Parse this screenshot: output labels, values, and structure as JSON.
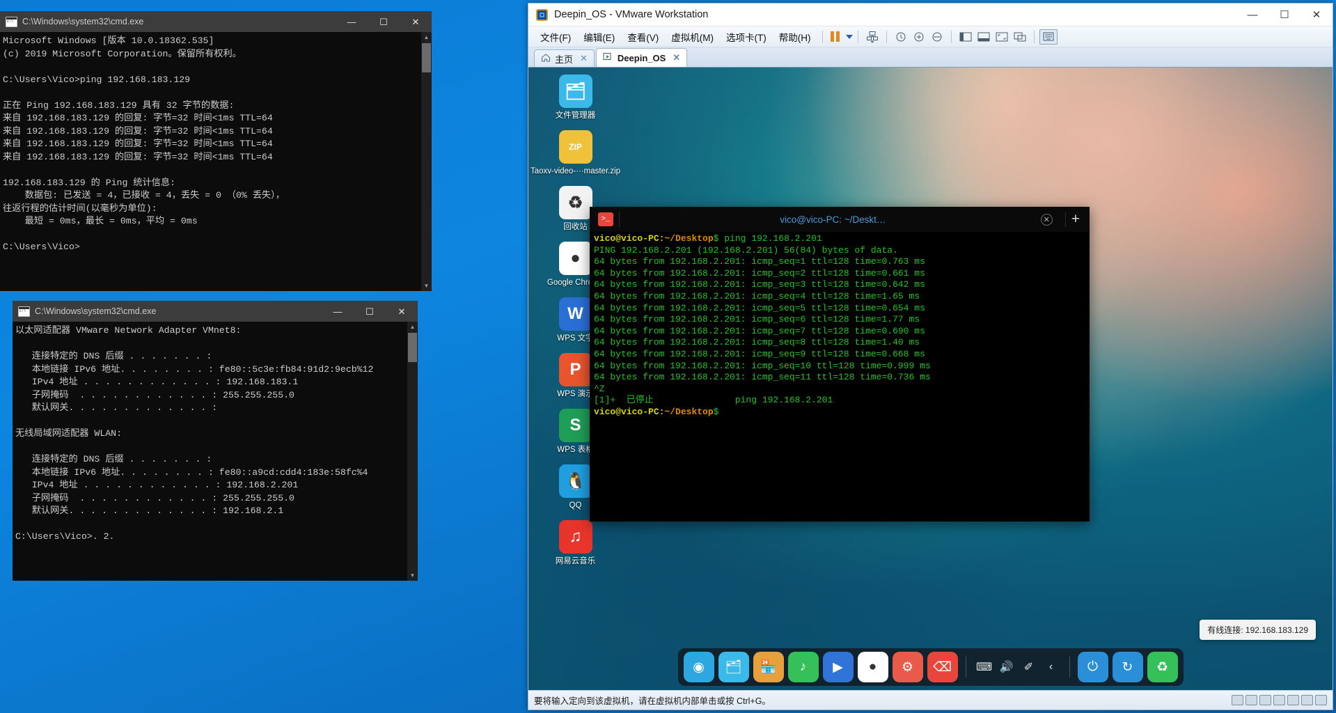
{
  "cmd_window_1": {
    "title": "C:\\Windows\\system32\\cmd.exe",
    "icon": "cmd-icon",
    "minimize": "—",
    "maximize": "☐",
    "close": "✕",
    "lines": [
      "Microsoft Windows [版本 10.0.18362.535]",
      "(c) 2019 Microsoft Corporation。保留所有权利。",
      "",
      "C:\\Users\\Vico>ping 192.168.183.129",
      "",
      "正在 Ping 192.168.183.129 具有 32 字节的数据:",
      "来自 192.168.183.129 的回复: 字节=32 时间<1ms TTL=64",
      "来自 192.168.183.129 的回复: 字节=32 时间<1ms TTL=64",
      "来自 192.168.183.129 的回复: 字节=32 时间<1ms TTL=64",
      "来自 192.168.183.129 的回复: 字节=32 时间<1ms TTL=64",
      "",
      "192.168.183.129 的 Ping 统计信息:",
      "    数据包: 已发送 = 4，已接收 = 4，丢失 = 0 （0% 丢失），",
      "往返行程的估计时间(以毫秒为单位):",
      "    最短 = 0ms，最长 = 0ms，平均 = 0ms",
      "",
      "C:\\Users\\Vico>"
    ]
  },
  "cmd_window_2": {
    "title": "C:\\Windows\\system32\\cmd.exe",
    "icon": "cmd-icon",
    "minimize": "—",
    "maximize": "☐",
    "close": "✕",
    "lines": [
      "以太网适配器 VMware Network Adapter VMnet8:",
      "",
      "   连接特定的 DNS 后缀 . . . . . . . :",
      "   本地链接 IPv6 地址. . . . . . . . : fe80::5c3e:fb84:91d2:9ecb%12",
      "   IPv4 地址 . . . . . . . . . . . . : 192.168.183.1",
      "   子网掩码  . . . . . . . . . . . . : 255.255.255.0",
      "   默认网关. . . . . . . . . . . . . :",
      "",
      "无线局域网适配器 WLAN:",
      "",
      "   连接特定的 DNS 后缀 . . . . . . . :",
      "   本地链接 IPv6 地址. . . . . . . . : fe80::a9cd:cdd4:183e:58fc%4",
      "   IPv4 地址 . . . . . . . . . . . . : 192.168.2.201",
      "   子网掩码  . . . . . . . . . . . . : 255.255.255.0",
      "   默认网关. . . . . . . . . . . . . : 192.168.2.1",
      "",
      "C:\\Users\\Vico>. 2."
    ]
  },
  "vmware": {
    "title": "Deepin_OS - VMware Workstation",
    "logo_icon": "vmware-logo-icon",
    "minimize": "—",
    "maximize": "☐",
    "close": "✕",
    "menu": [
      {
        "label": "文件(F)",
        "accel": "F"
      },
      {
        "label": "编辑(E)",
        "accel": "E"
      },
      {
        "label": "查看(V)",
        "accel": "V"
      },
      {
        "label": "虚拟机(M)",
        "accel": "M"
      },
      {
        "label": "选项卡(T)",
        "accel": "T"
      },
      {
        "label": "帮助(H)",
        "accel": "H"
      }
    ],
    "toolbar_icons": [
      "pause-icon",
      "dropdown-caret-icon",
      "snapshot-icon",
      "revert-snapshot-icon",
      "snapshot-manager-icon",
      "show-console-icon",
      "panel-left-icon",
      "panel-bottom-icon",
      "fullscreen-icon",
      "unity-icon",
      "stretch-icon",
      "send-ctrl-alt-del-icon"
    ],
    "tabs": [
      {
        "label": "主页",
        "icon": "home-icon",
        "close": "✕",
        "active": false
      },
      {
        "label": "Deepin_OS",
        "icon": "vm-icon",
        "close": "✕",
        "active": true
      }
    ],
    "status_message": "要将输入定向到该虚拟机，请在虚拟机内部单击或按 Ctrl+G。"
  },
  "deepin": {
    "desktop_icons": [
      {
        "label": "文件管理器",
        "icon": "file-manager-icon",
        "glyph": "🗂",
        "color": "#3bb9e8"
      },
      {
        "label": "Taoxv-video-···master.zip",
        "icon": "zip-archive-icon",
        "glyph": "ZIP",
        "color": "#f0c23a"
      },
      {
        "label": "回收站",
        "icon": "trash-icon",
        "glyph": "♻",
        "color": "#f2f2f2"
      },
      {
        "label": "Google Chrome",
        "icon": "chrome-icon",
        "glyph": "●",
        "color": "#ffffff"
      },
      {
        "label": "WPS 文字",
        "icon": "wps-writer-icon",
        "glyph": "W",
        "color": "#2a6fd6"
      },
      {
        "label": "WPS 演示",
        "icon": "wps-presentation-icon",
        "glyph": "P",
        "color": "#e8552d"
      },
      {
        "label": "WPS 表格",
        "icon": "wps-spreadsheet-icon",
        "glyph": "S",
        "color": "#1f9e57"
      },
      {
        "label": "QQ",
        "icon": "qq-icon",
        "glyph": "🐧",
        "color": "#1f9fe0"
      },
      {
        "label": "网易云音乐",
        "icon": "netease-music-icon",
        "glyph": "♫",
        "color": "#e8342b"
      }
    ],
    "terminal": {
      "tab_title": "vico@vico-PC: ~/Deskt…",
      "icon": "terminal-icon",
      "close": "✕",
      "new_tab": "+",
      "lines": [
        {
          "type": "prompt",
          "user": "vico@vico-PC",
          "sep": ":",
          "path": "~/Desktop",
          "dollar": "$",
          "cmd": " ping 192.168.2.201"
        },
        {
          "type": "out",
          "text": "PING 192.168.2.201 (192.168.2.201) 56(84) bytes of data."
        },
        {
          "type": "out",
          "text": "64 bytes from 192.168.2.201: icmp_seq=1 ttl=128 time=0.763 ms"
        },
        {
          "type": "out",
          "text": "64 bytes from 192.168.2.201: icmp_seq=2 ttl=128 time=0.661 ms"
        },
        {
          "type": "out",
          "text": "64 bytes from 192.168.2.201: icmp_seq=3 ttl=128 time=0.642 ms"
        },
        {
          "type": "out",
          "text": "64 bytes from 192.168.2.201: icmp_seq=4 ttl=128 time=1.65 ms"
        },
        {
          "type": "out",
          "text": "64 bytes from 192.168.2.201: icmp_seq=5 ttl=128 time=0.654 ms"
        },
        {
          "type": "out",
          "text": "64 bytes from 192.168.2.201: icmp_seq=6 ttl=128 time=1.77 ms"
        },
        {
          "type": "out",
          "text": "64 bytes from 192.168.2.201: icmp_seq=7 ttl=128 time=0.690 ms"
        },
        {
          "type": "out",
          "text": "64 bytes from 192.168.2.201: icmp_seq=8 ttl=128 time=1.40 ms"
        },
        {
          "type": "out",
          "text": "64 bytes from 192.168.2.201: icmp_seq=9 ttl=128 time=0.668 ms"
        },
        {
          "type": "out",
          "text": "64 bytes from 192.168.2.201: icmp_seq=10 ttl=128 time=0.999 ms"
        },
        {
          "type": "out",
          "text": "64 bytes from 192.168.2.201: icmp_seq=11 ttl=128 time=0.736 ms"
        },
        {
          "type": "out",
          "text": "^Z"
        },
        {
          "type": "out",
          "text": "[1]+  已停止               ping 192.168.2.201"
        },
        {
          "type": "prompt",
          "user": "vico@vico-PC",
          "sep": ":",
          "path": "~/Desktop",
          "dollar": "$",
          "cmd": ""
        }
      ]
    },
    "tooltip": "有线连接: 192.168.183.129",
    "dock_items": [
      {
        "icon": "launcher-icon",
        "glyph": "◉",
        "color": "#2ca7e0"
      },
      {
        "icon": "file-manager-dock-icon",
        "glyph": "🗂",
        "color": "#3bb9e8"
      },
      {
        "icon": "app-store-icon",
        "glyph": "🏪",
        "color": "#e8a13a"
      },
      {
        "icon": "music-icon",
        "glyph": "♪",
        "color": "#35c05a"
      },
      {
        "icon": "movie-icon",
        "glyph": "▶",
        "color": "#2f74d6"
      },
      {
        "icon": "chrome-dock-icon",
        "glyph": "●",
        "color": "#ffffff"
      },
      {
        "icon": "settings-icon",
        "glyph": "⚙",
        "color": "#e85a4a"
      },
      {
        "icon": "terminal-dock-icon",
        "glyph": "⌫",
        "color": "#e8453c"
      }
    ],
    "tray_items": [
      {
        "icon": "keyboard-icon",
        "glyph": "⌨"
      },
      {
        "icon": "volume-icon",
        "glyph": "🔊"
      },
      {
        "icon": "network-icon",
        "glyph": "✐"
      },
      {
        "icon": "tray-expand-icon",
        "glyph": "‹"
      }
    ],
    "dock_power_items": [
      {
        "icon": "power-icon",
        "glyph": "⏻",
        "color": "#2a8fd6"
      },
      {
        "icon": "update-icon",
        "glyph": "↻",
        "color": "#2a8fd6"
      },
      {
        "icon": "trash-dock-icon",
        "glyph": "♻",
        "color": "#35c05a"
      }
    ]
  },
  "colors": {
    "vmware_accent": "#e08a1e",
    "windows_blue": "#0a6fc2",
    "terminal_green": "#22c322",
    "prompt_yellow": "#d6d600",
    "prompt_orange": "#e08a00"
  }
}
